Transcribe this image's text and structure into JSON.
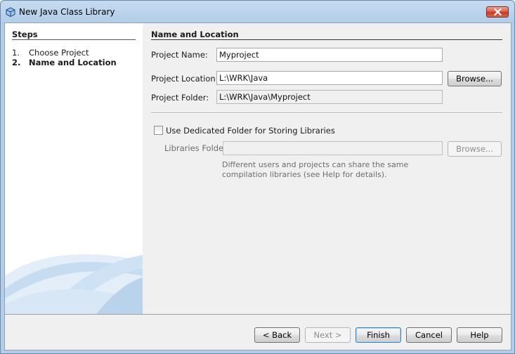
{
  "window": {
    "title": "New Java Class Library"
  },
  "steps": {
    "heading": "Steps",
    "items": [
      {
        "num": "1.",
        "label": "Choose Project"
      },
      {
        "num": "2.",
        "label": "Name and Location"
      }
    ],
    "current_index": 1
  },
  "panel": {
    "heading": "Name and Location",
    "project_name": {
      "label": "Project Name:",
      "value": "Myproject"
    },
    "project_location": {
      "label": "Project Location:",
      "value": "L:\\WRK\\Java",
      "browse_label": "Browse..."
    },
    "project_folder": {
      "label": "Project Folder:",
      "value": "L:\\WRK\\Java\\Myproject"
    },
    "dedicated_folder": {
      "label": "Use Dedicated Folder for Storing Libraries",
      "checked": false
    },
    "libraries_folder": {
      "label": "Libraries Folder:",
      "value": "",
      "browse_label": "Browse..."
    },
    "hint": "Different users and projects can share the same compilation libraries (see Help for details)."
  },
  "footer": {
    "back": "< Back",
    "next": "Next >",
    "finish": "Finish",
    "cancel": "Cancel",
    "help": "Help"
  },
  "icons": {
    "app": "java-cube-icon",
    "close": "close-icon"
  }
}
